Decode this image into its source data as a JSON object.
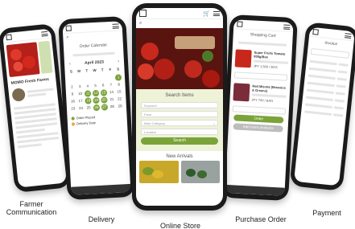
{
  "captions": {
    "farmer": "Farmer\nCommunication",
    "delivery": "Delivery",
    "store": "Online Store",
    "purchase": "Purchase Order",
    "payment": "Payment"
  },
  "farmer_screen": {
    "farm_name": "MOMO Fresh Farms"
  },
  "delivery_screen": {
    "title": "Order Calendar",
    "month": "April 2023",
    "weekdays": [
      "S",
      "M",
      "T",
      "W",
      "T",
      "F",
      "S"
    ],
    "days": [
      "",
      "",
      "",
      "",
      "",
      "",
      "1",
      "2",
      "3",
      "4",
      "5",
      "6",
      "7",
      "8",
      "9",
      "10",
      "11",
      "12",
      "13",
      "14",
      "15",
      "16",
      "17",
      "18",
      "19",
      "20",
      "21",
      "22",
      "23",
      "24",
      "25",
      "26",
      "27",
      "28",
      "29"
    ],
    "legend_a": "Order Placed",
    "legend_b": "Delivery Date"
  },
  "store_screen": {
    "search_title": "Search Items",
    "field_keyword": "Keyword",
    "field_farm": "Farm",
    "field_category": "Main Category",
    "field_location": "Location",
    "search_button": "Search",
    "new_arrivals": "New Arrivals"
  },
  "purchase_screen": {
    "title": "Shopping Cart",
    "item1": "Super Fruits Tomato 800g/Box",
    "item1_price": "JPY 1,500 / BOX",
    "item2": "Red Mizuna (Brassica & Greens)",
    "item2_price": "JPY 700 / BAG",
    "order_button": "Order",
    "add_more": "Add more products"
  },
  "payment_screen": {
    "title": "Invoice"
  }
}
